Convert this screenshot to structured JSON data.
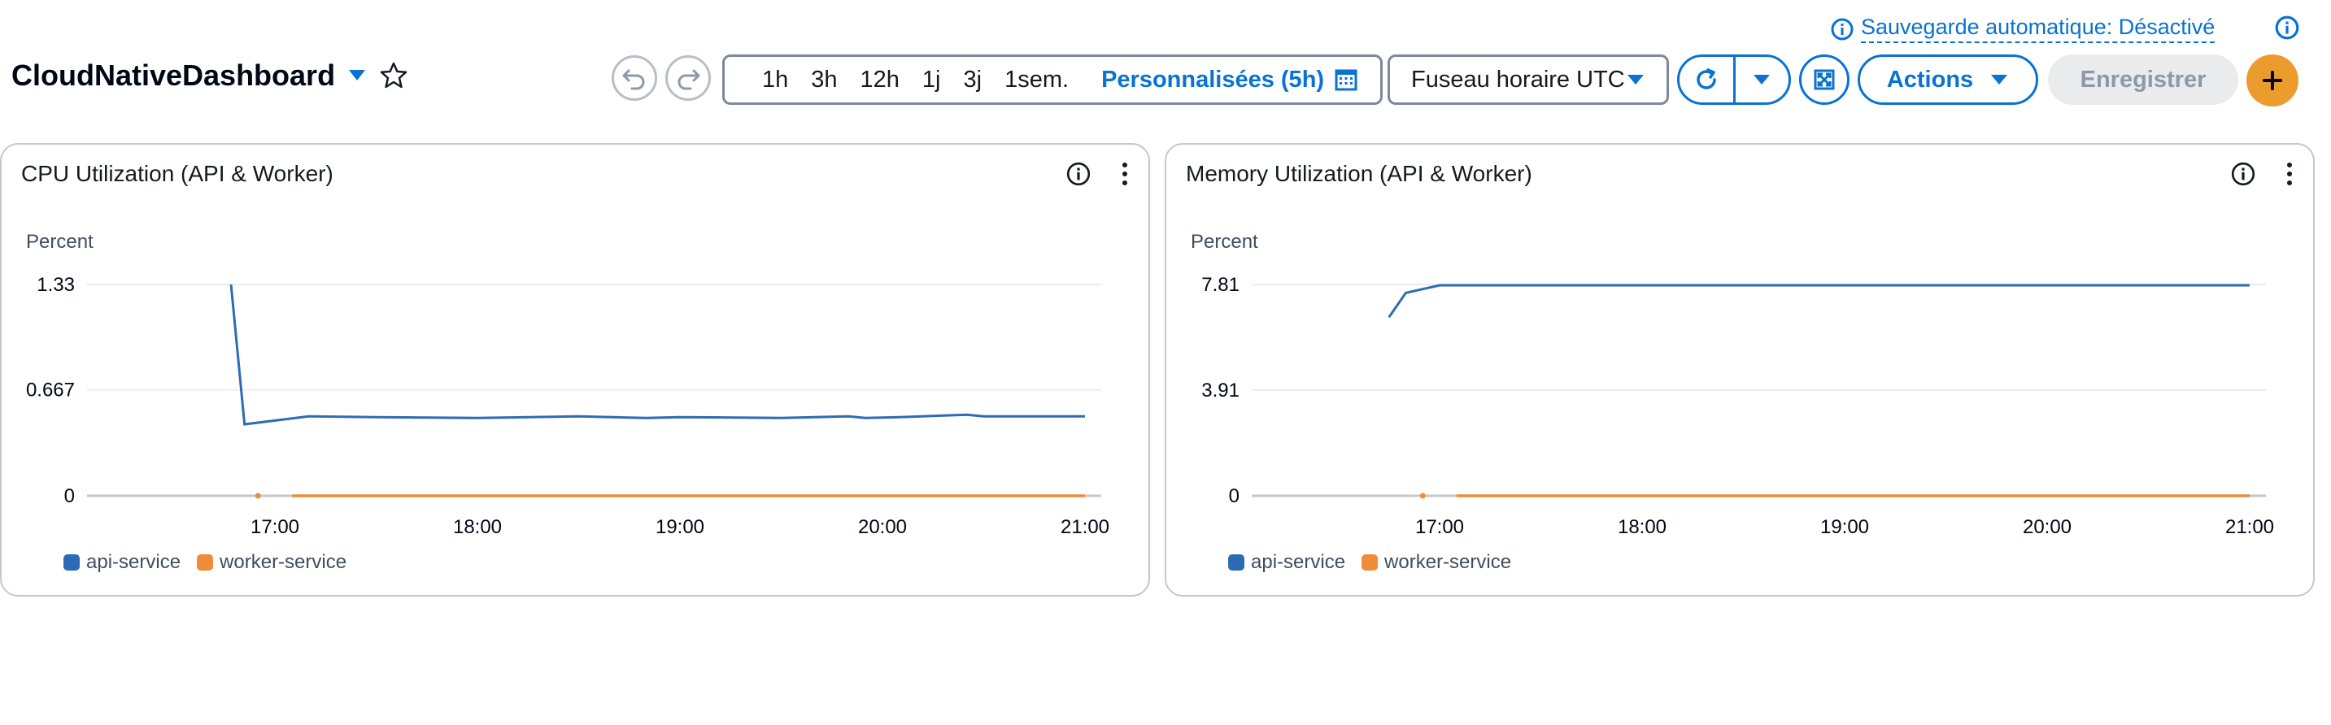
{
  "autosave": {
    "label": "Sauvegarde automatique: Désactivé"
  },
  "header": {
    "title": "CloudNativeDashboard",
    "time_ranges": [
      "1h",
      "3h",
      "12h",
      "1j",
      "3j",
      "1sem."
    ],
    "custom_range": "Personnalisées (5h)",
    "timezone": "Fuseau horaire UTC",
    "actions_label": "Actions",
    "save_label": "Enregistrer"
  },
  "colors": {
    "accent": "#0972d3",
    "api": "#2e6bb5",
    "worker": "#f08c37",
    "add": "#ec9b2d"
  },
  "widgets": [
    {
      "title": "CPU Utilization (API & Worker)",
      "unit": "Percent"
    },
    {
      "title": "Memory Utilization (API & Worker)",
      "unit": "Percent"
    }
  ],
  "legend": [
    "api-service",
    "worker-service"
  ],
  "chart_data": [
    {
      "type": "line",
      "title": "CPU Utilization (API & Worker)",
      "ylabel": "Percent",
      "yticks": [
        "0",
        "0.667",
        "1.33"
      ],
      "ylim": [
        0,
        1.33
      ],
      "xticks": [
        "17:00",
        "18:00",
        "19:00",
        "20:00",
        "21:00"
      ],
      "xlim": [
        "16:35",
        "21:00"
      ],
      "series": [
        {
          "name": "api-service",
          "color": "#2e6bb5",
          "points": [
            [
              "16:47",
              1.33
            ],
            [
              "16:51",
              0.45
            ],
            [
              "17:10",
              0.5
            ],
            [
              "17:30",
              0.495
            ],
            [
              "18:00",
              0.49
            ],
            [
              "18:30",
              0.5
            ],
            [
              "18:50",
              0.49
            ],
            [
              "19:00",
              0.495
            ],
            [
              "19:30",
              0.49
            ],
            [
              "19:50",
              0.5
            ],
            [
              "19:55",
              0.49
            ],
            [
              "20:05",
              0.495
            ],
            [
              "20:25",
              0.51
            ],
            [
              "20:30",
              0.5
            ],
            [
              "21:00",
              0.5
            ]
          ]
        },
        {
          "name": "worker-service",
          "color": "#f08c37",
          "points": [
            [
              "16:55",
              0
            ],
            [
              "17:05",
              0
            ],
            [
              "21:00",
              0
            ]
          ]
        }
      ]
    },
    {
      "type": "line",
      "title": "Memory Utilization (API & Worker)",
      "ylabel": "Percent",
      "yticks": [
        "0",
        "3.91",
        "7.81"
      ],
      "ylim": [
        0,
        7.81
      ],
      "xticks": [
        "17:00",
        "18:00",
        "19:00",
        "20:00",
        "21:00"
      ],
      "xlim": [
        "16:35",
        "21:00"
      ],
      "series": [
        {
          "name": "api-service",
          "color": "#2e6bb5",
          "points": [
            [
              "16:45",
              6.6
            ],
            [
              "16:50",
              7.5
            ],
            [
              "17:00",
              7.78
            ],
            [
              "18:00",
              7.78
            ],
            [
              "19:00",
              7.78
            ],
            [
              "20:00",
              7.78
            ],
            [
              "21:00",
              7.78
            ]
          ]
        },
        {
          "name": "worker-service",
          "color": "#f08c37",
          "points": [
            [
              "16:55",
              0
            ],
            [
              "17:05",
              0
            ],
            [
              "21:00",
              0
            ]
          ]
        }
      ]
    }
  ]
}
